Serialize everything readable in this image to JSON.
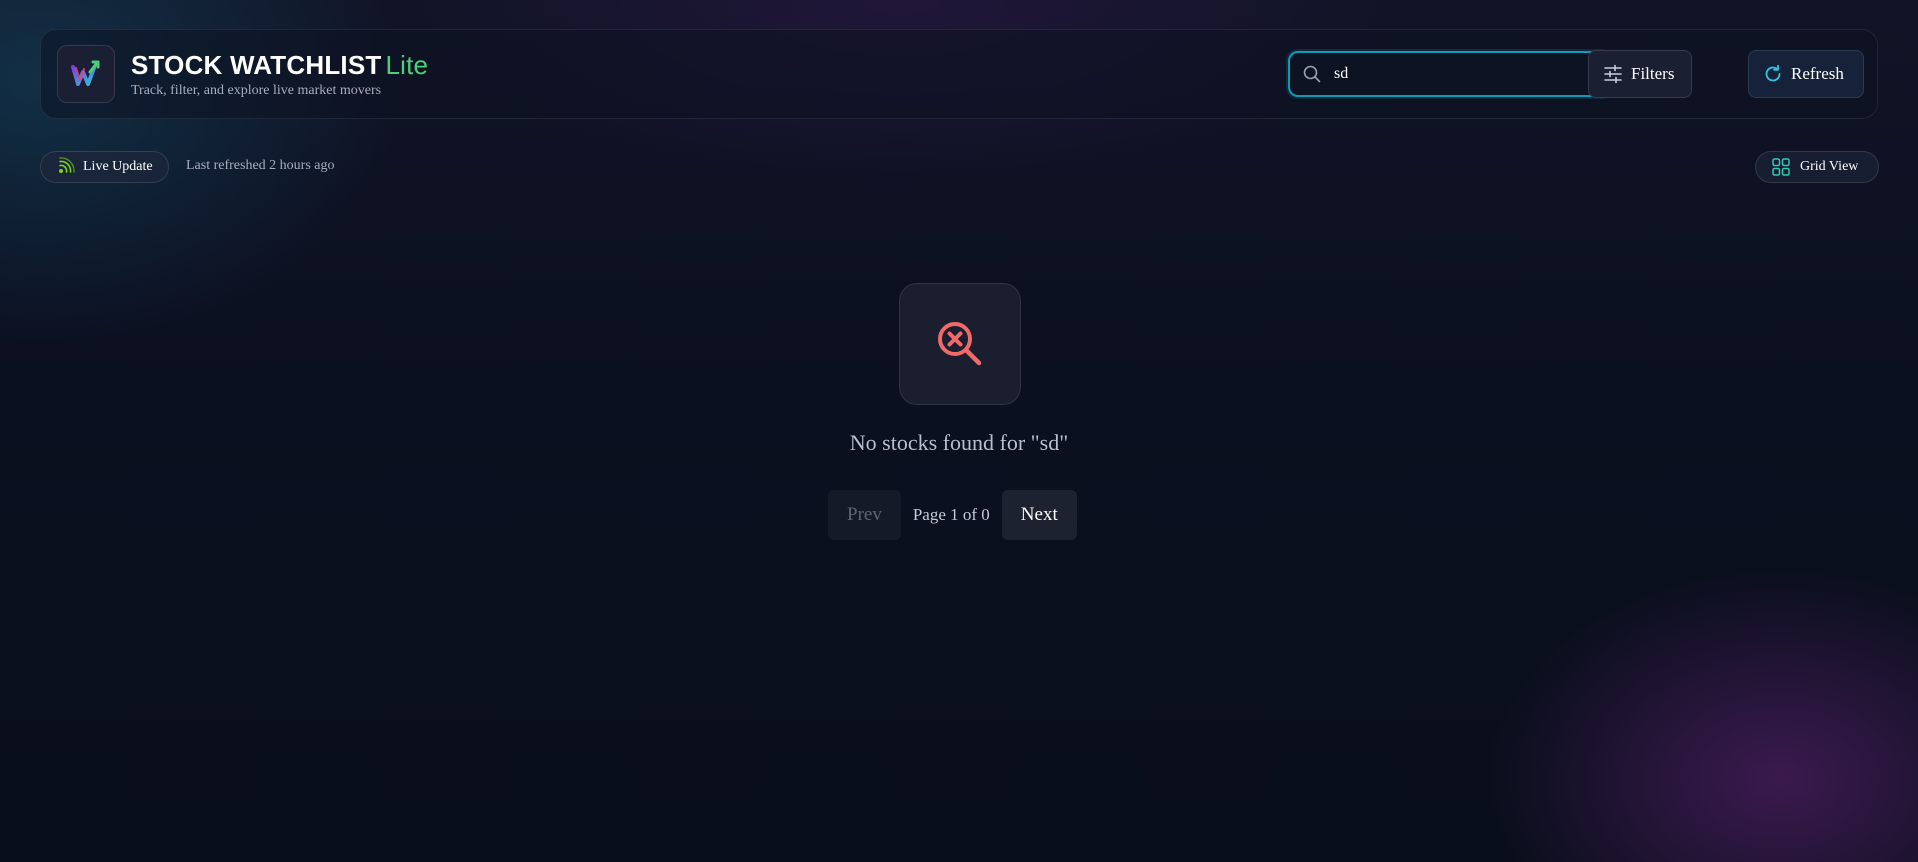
{
  "header": {
    "title": "STOCK WATCHLIST",
    "title_suffix": "Lite",
    "subtitle": "Track, filter, and explore live market movers",
    "logo_icon": "w-chart-logo-icon"
  },
  "search": {
    "value": "sd",
    "placeholder": "",
    "icon": "search-icon"
  },
  "toolbar": {
    "filters_label": "Filters",
    "filters_icon": "sliders-icon",
    "refresh_label": "Refresh",
    "refresh_icon": "refresh-icon"
  },
  "status": {
    "live_label": "Live Update",
    "live_icon": "broadcast-icon",
    "last_refreshed": "Last refreshed 2 hours ago",
    "view_toggle_label": "Grid View",
    "view_toggle_icon": "grid-icon"
  },
  "empty_state": {
    "icon": "search-x-icon",
    "message": "No stocks found for \"sd\""
  },
  "pagination": {
    "prev_label": "Prev",
    "info": "Page 1 of 0",
    "next_label": "Next"
  },
  "colors": {
    "accent": "#0e9bb3",
    "lite_green": "#4ccf7a",
    "error_red": "#f06a6a",
    "live_green": "#7ed321"
  }
}
